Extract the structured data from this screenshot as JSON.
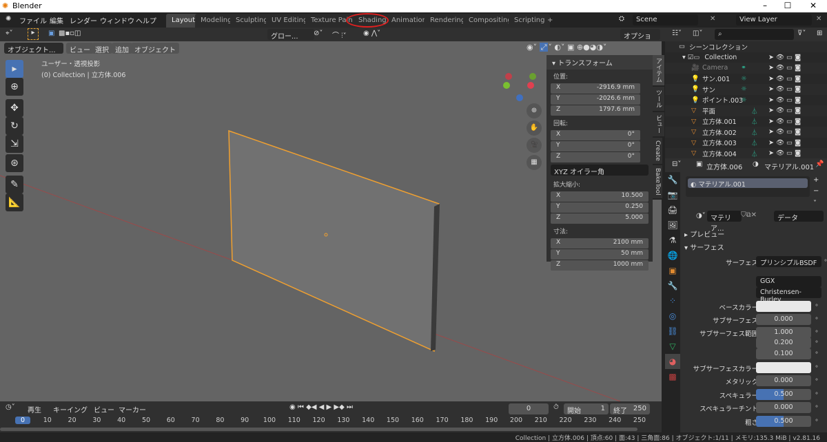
{
  "window": {
    "title": "Blender",
    "min": "–",
    "max": "☐",
    "close": "✕"
  },
  "menu": [
    "ファイル",
    "編集",
    "レンダー",
    "ウィンドウ",
    "ヘルプ"
  ],
  "workspaces": [
    "Layout",
    "Modeling",
    "Sculpting",
    "UV Editing",
    "Texture Paint",
    "Shading",
    "Animation",
    "Rendering",
    "Compositing",
    "Scripting",
    "+"
  ],
  "active_workspace": "Layout",
  "annotation_color": "#e02020",
  "scene": {
    "name": "Scene",
    "view_layer": "View Layer"
  },
  "header": {
    "orientation": "グロー...",
    "options": "オプション"
  },
  "viewport": {
    "mode": "オブジェクト...",
    "menus": [
      "ビュー",
      "選択",
      "追加",
      "オブジェクト"
    ],
    "view_name": "ユーザー・透視投影",
    "collection_info": "(0) Collection | 立方体.006",
    "selection_color": "#f0a030"
  },
  "npanel": {
    "section": "トランスフォーム",
    "location_label": "位置:",
    "location": {
      "X": "-2916.9 mm",
      "Y": "-2026.6 mm",
      "Z": "1797.6 mm"
    },
    "rotation_label": "回転:",
    "rotation": {
      "X": "0°",
      "Y": "0°",
      "Z": "0°"
    },
    "rotation_mode": "XYZ オイラー角",
    "scale_label": "拡大縮小:",
    "scale": {
      "X": "10.500",
      "Y": "0.250",
      "Z": "5.000"
    },
    "dimensions_label": "寸法:",
    "dimensions": {
      "X": "2100 mm",
      "Y": "50 mm",
      "Z": "1000 mm"
    },
    "tabs": [
      "アイテム",
      "ツール",
      "ビュー",
      "Create",
      "BakeTool"
    ]
  },
  "outliner": {
    "root": "シーンコレクション",
    "items": [
      {
        "name": "Collection",
        "type": "collection"
      },
      {
        "name": "Camera",
        "type": "camera"
      },
      {
        "name": "サン.001",
        "type": "light"
      },
      {
        "name": "サン",
        "type": "light"
      },
      {
        "name": "ポイント.003",
        "type": "light"
      },
      {
        "name": "平面",
        "type": "mesh"
      },
      {
        "name": "立方体.001",
        "type": "mesh"
      },
      {
        "name": "立方体.002",
        "type": "mesh"
      },
      {
        "name": "立方体.003",
        "type": "mesh"
      },
      {
        "name": "立方体.004",
        "type": "mesh"
      }
    ]
  },
  "properties": {
    "object": "立方体.006",
    "material": "マテリアル.001",
    "slot": "マテリアル.001",
    "mat_short": "マテリア...",
    "link": "データ",
    "preview": "プレビュー",
    "surface_section": "サーフェス",
    "rows": [
      {
        "label": "サーフェス",
        "value": "プリンシプルBSDF"
      },
      {
        "label": "",
        "value": "GGX"
      },
      {
        "label": "",
        "value": "Christensen-Burley"
      },
      {
        "label": "ベースカラー",
        "value": ""
      },
      {
        "label": "サブサーフェス",
        "value": "0.000"
      },
      {
        "label": "サブサーフェス範囲",
        "value": "1.000"
      },
      {
        "label": "",
        "value": "0.200"
      },
      {
        "label": "",
        "value": "0.100"
      },
      {
        "label": "サブサーフェスカラー",
        "value": ""
      },
      {
        "label": "メタリック",
        "value": "0.000"
      },
      {
        "label": "スペキュラー",
        "value": "0.500",
        "fill": 0.5
      },
      {
        "label": "スペキュラーチント",
        "value": "0.000"
      },
      {
        "label": "粗さ",
        "value": "0.500",
        "fill": 0.5
      }
    ]
  },
  "timeline": {
    "menus": [
      "再生",
      "キーイング",
      "ビュー",
      "マーカー"
    ],
    "current_frame": "0",
    "start_label": "開始",
    "start": "1",
    "end_label": "終了",
    "end": "250",
    "ticks": [
      "0",
      "10",
      "20",
      "30",
      "40",
      "50",
      "60",
      "70",
      "80",
      "90",
      "100",
      "110",
      "120",
      "130",
      "140",
      "150",
      "160",
      "170",
      "180",
      "190",
      "200",
      "210",
      "220",
      "230",
      "240",
      "250"
    ]
  },
  "status": "Collection | 立方体.006 | 頂点:60 | 面:43 | 三角面:86 | オブジェクト:1/11 | メモリ:135.3 MiB | v2.81.16"
}
